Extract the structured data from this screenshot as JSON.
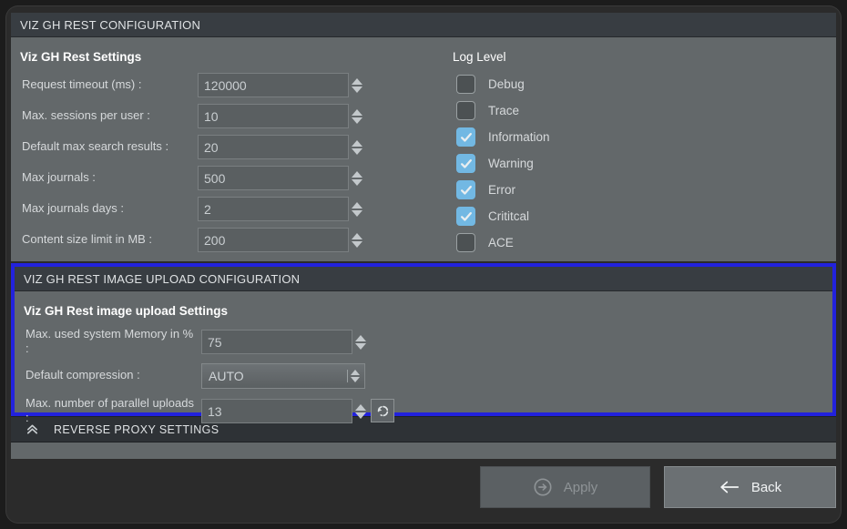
{
  "window": {
    "title": "VIZ GH REST CONFIGURATION"
  },
  "rest_settings": {
    "group_title": "Viz GH Rest Settings",
    "fields": [
      {
        "label": "Request timeout (ms) :",
        "value": "120000",
        "control": "spinner"
      },
      {
        "label": "Max. sessions per user :",
        "value": "10",
        "control": "spinner"
      },
      {
        "label": "Default max search results :",
        "value": "20",
        "control": "spinner"
      },
      {
        "label": "Max journals :",
        "value": "500",
        "control": "spinner"
      },
      {
        "label": "Max journals days :",
        "value": "2",
        "control": "spinner"
      },
      {
        "label": "Content size limit in MB :",
        "value": "200",
        "control": "spinner"
      }
    ]
  },
  "log_level": {
    "title": "Log Level",
    "items": [
      {
        "label": "Debug",
        "checked": false
      },
      {
        "label": "Trace",
        "checked": false
      },
      {
        "label": "Information",
        "checked": true
      },
      {
        "label": "Warning",
        "checked": true
      },
      {
        "label": "Error",
        "checked": true
      },
      {
        "label": "Crititcal",
        "checked": true
      },
      {
        "label": "ACE",
        "checked": false
      }
    ]
  },
  "image_upload": {
    "header": "VIZ GH REST IMAGE UPLOAD CONFIGURATION",
    "group_title": "Viz GH Rest image upload Settings",
    "memory": {
      "label": "Max. used system Memory in % :",
      "value": "75"
    },
    "compression": {
      "label": "Default compression :",
      "value": "AUTO"
    },
    "parallel_uploads": {
      "label": "Max. number of parallel uploads :",
      "value": "13",
      "reset_icon": "reset-circular-arrow-icon"
    }
  },
  "reverse_proxy": {
    "label": "REVERSE PROXY SETTINGS",
    "chevron_icon": "double-chevron-up-icon"
  },
  "footer": {
    "apply_label": "Apply",
    "apply_icon": "circled-arrow-right-icon",
    "apply_disabled": true,
    "back_label": "Back",
    "back_icon": "arrow-left-icon"
  },
  "colors": {
    "panel_bg": "#63686a",
    "header_bg": "#383d42",
    "focus_border": "#2222dd",
    "checkbox_on": "#72b8e3",
    "text": "#d6d9db"
  }
}
